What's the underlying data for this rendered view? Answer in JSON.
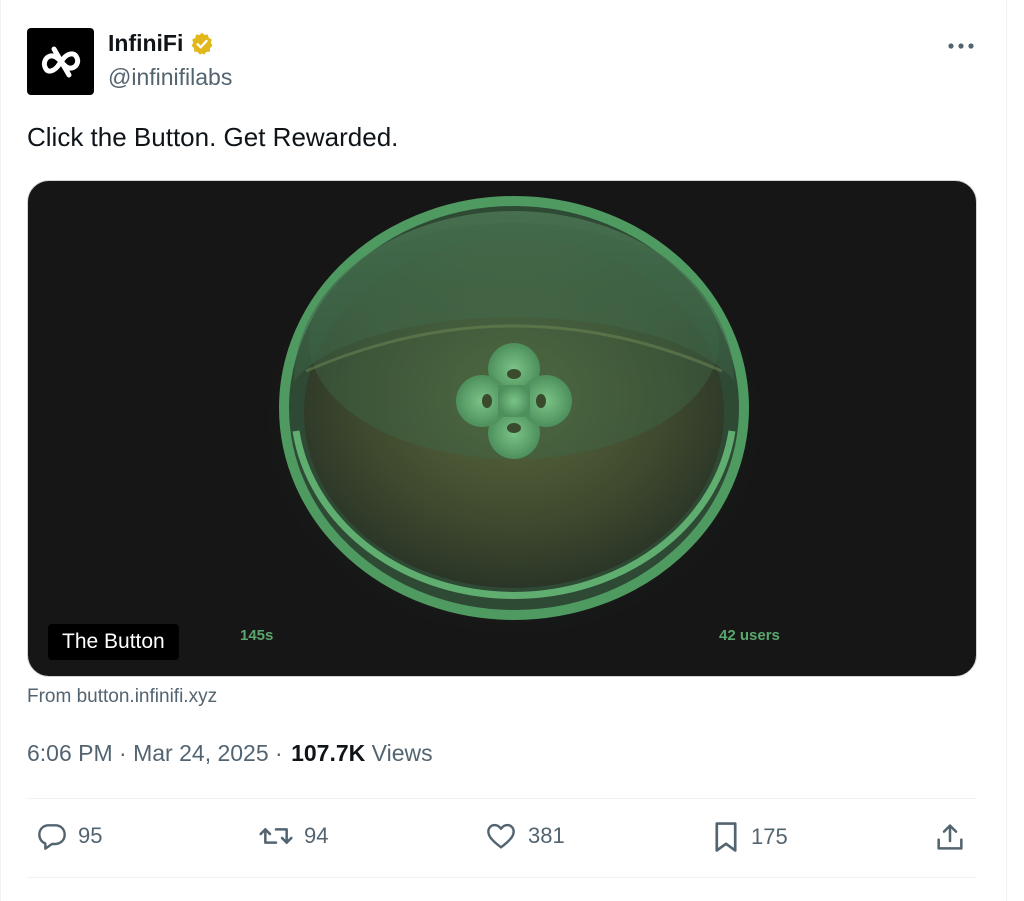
{
  "author": {
    "name": "InfiniFi",
    "handle": "@infinifilabs",
    "verified_badge_color": "#e2b719"
  },
  "more_icon": "more-horizontal-icon",
  "tweet": {
    "text": "Click the Button. Get Rewarded."
  },
  "media": {
    "label": "The Button",
    "timer": "145s",
    "users": "42 users",
    "accent_color": "#5aa66e"
  },
  "source": {
    "text": "From button.infinifi.xyz"
  },
  "meta": {
    "time": "6:06 PM",
    "separator": " · ",
    "date": "Mar 24, 2025",
    "views_count": "107.7K",
    "views_label": " Views"
  },
  "actions": {
    "replies": {
      "icon": "reply-icon",
      "count": "95"
    },
    "reposts": {
      "icon": "repost-icon",
      "count": "94"
    },
    "likes": {
      "icon": "heart-icon",
      "count": "381"
    },
    "bookmarks": {
      "icon": "bookmark-icon",
      "count": "175"
    },
    "share": {
      "icon": "share-icon"
    }
  }
}
